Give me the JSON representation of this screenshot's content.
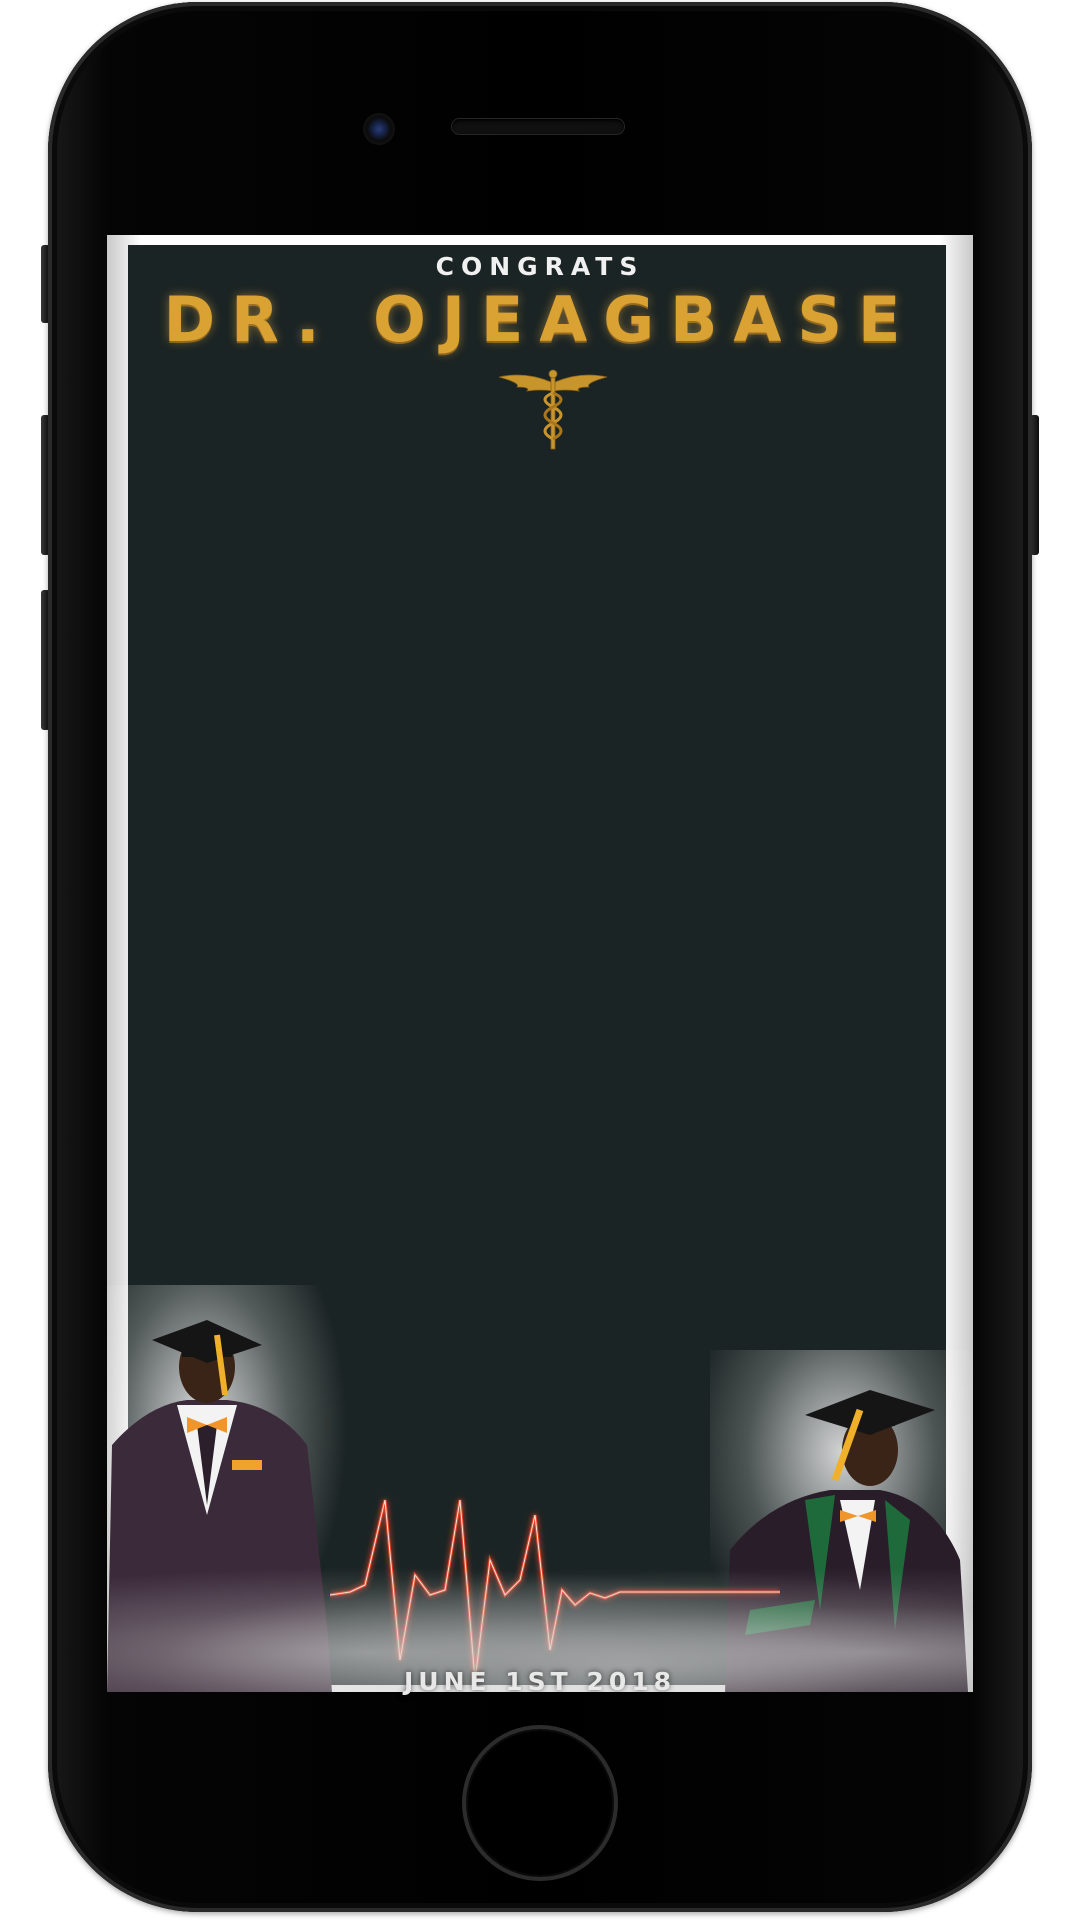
{
  "filter": {
    "congrats_text": "CONGRATS",
    "title": "DR. OJEAGBASE",
    "emblem_icon": "caduceus-icon",
    "date_text": "JUNE 1ST 2018"
  },
  "device": {
    "type": "phone-mockup",
    "home_button_icon": "home-button-icon",
    "camera_icon": "front-camera-icon",
    "speaker_icon": "earpiece-speaker-icon"
  },
  "colors": {
    "background": "#1b2424",
    "gold": "#d9a233",
    "heartbeat": "#e0452a",
    "text_light": "#f0f0f0"
  }
}
